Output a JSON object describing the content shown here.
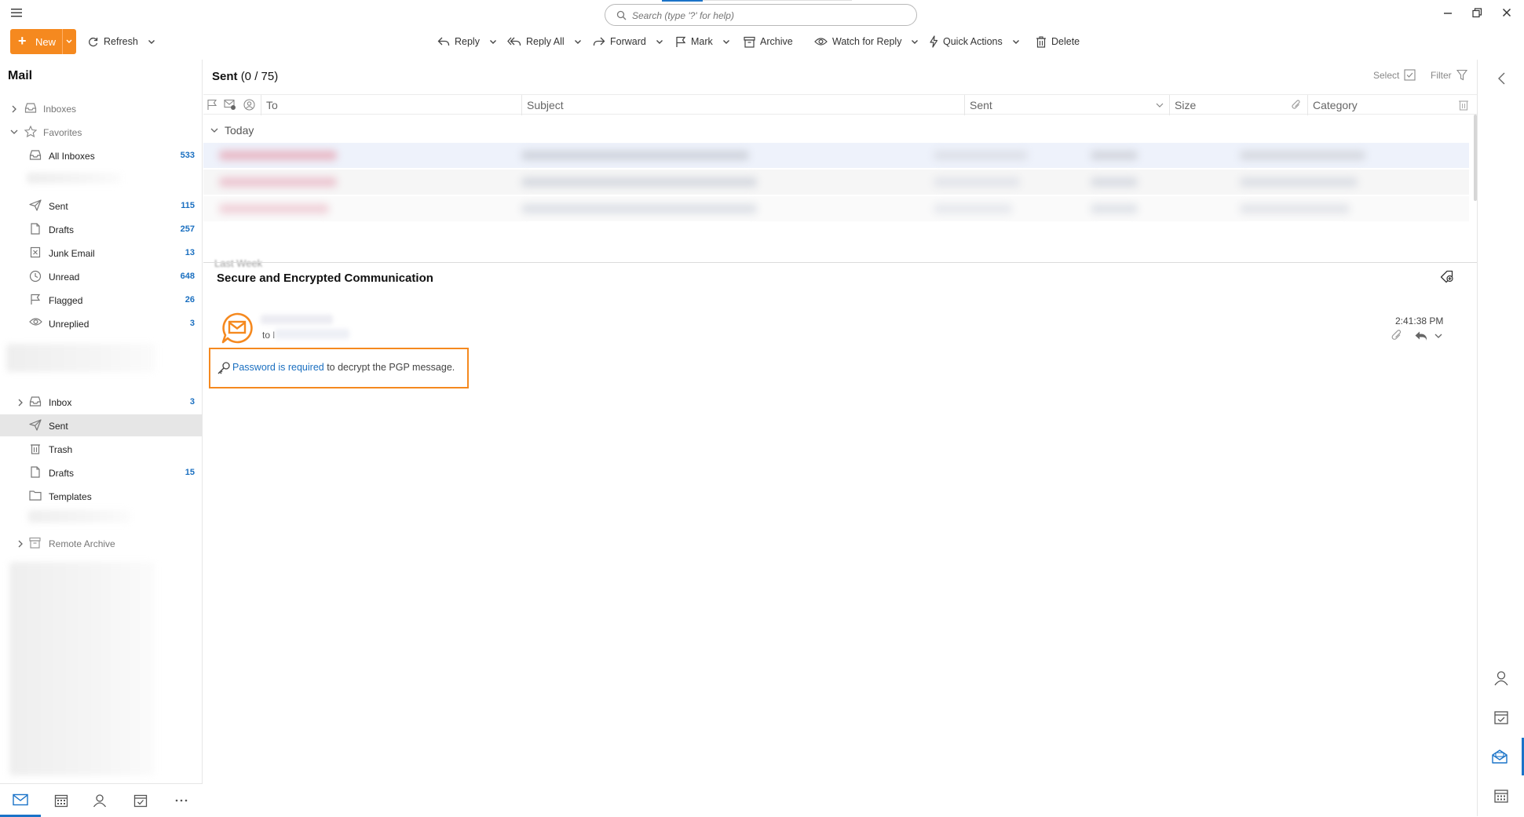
{
  "search": {
    "placeholder": "Search (type '?' for help)"
  },
  "toolbar": {
    "new_label": "New",
    "refresh_label": "Refresh",
    "reply_label": "Reply",
    "reply_all_label": "Reply All",
    "forward_label": "Forward",
    "mark_label": "Mark",
    "archive_label": "Archive",
    "watch_label": "Watch for Reply",
    "quick_actions_label": "Quick Actions",
    "delete_label": "Delete"
  },
  "sidebar": {
    "title": "Mail",
    "inboxes_label": "Inboxes",
    "favorites_label": "Favorites",
    "favorites": [
      {
        "label": "All Inboxes",
        "count": "533",
        "icon": "inbox-icon"
      },
      {
        "label": "Sent",
        "count": "115",
        "icon": "sent-icon"
      },
      {
        "label": "Drafts",
        "count": "257",
        "icon": "draft-icon"
      },
      {
        "label": "Junk Email",
        "count": "13",
        "icon": "junk-icon"
      },
      {
        "label": "Unread",
        "count": "648",
        "icon": "clock-icon"
      },
      {
        "label": "Flagged",
        "count": "26",
        "icon": "flag-icon"
      },
      {
        "label": "Unreplied",
        "count": "3",
        "icon": "eye-icon"
      }
    ],
    "account_folders": [
      {
        "label": "Inbox",
        "count": "3",
        "icon": "inbox-icon"
      },
      {
        "label": "Sent",
        "count": "",
        "icon": "sent-icon"
      },
      {
        "label": "Trash",
        "count": "",
        "icon": "trash-icon"
      },
      {
        "label": "Drafts",
        "count": "15",
        "icon": "draft-icon"
      },
      {
        "label": "Templates",
        "count": "",
        "icon": "folder-icon"
      }
    ],
    "remote_archive_label": "Remote Archive"
  },
  "list": {
    "folder_name": "Sent",
    "folder_count": "(0 / 75)",
    "select_label": "Select",
    "filter_label": "Filter",
    "columns": {
      "to": "To",
      "subject": "Subject",
      "sent": "Sent",
      "size": "Size",
      "category": "Category"
    },
    "group_today": "Today",
    "group_last_week": "Last Week"
  },
  "message": {
    "subject": "Secure and Encrypted Communication",
    "to_prefix": "to l",
    "time": "2:41:38 PM",
    "pgp_link": "Password is required",
    "pgp_rest": " to decrypt the PGP message."
  },
  "colors": {
    "accent": "#f5891f",
    "link": "#1a6fc0",
    "selection": "#1a73c8"
  }
}
